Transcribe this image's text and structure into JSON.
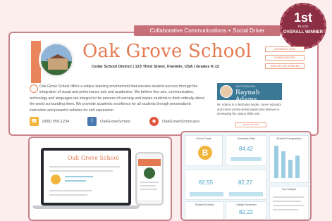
{
  "banner": {
    "text": "Collaborative Communications + Social Driver"
  },
  "badge": {
    "rank": "1st",
    "place": "PLACE",
    "award": "OVERALL WINNER"
  },
  "header": {
    "school_name": "Oak Grove School",
    "subtitle": "Cedar School District | 123 Third Street, Franklin, USA | Grades K-12"
  },
  "side_buttons": [
    "SCHEDULE VISIT",
    "DOWNLOAD PDF",
    "SIGN UP FOR UPDATES"
  ],
  "description": "Oak Grove School offers a unique learning environment that ensures student success through the integration of visual and performance arts and academics. We believe fine arts, communication, technology and languages are integral to the process of learning and inspire students to think critically about the world surrounding them. We promote academic excellence for all students through personalized instruction and powerful vehicles for self-expression.",
  "contacts": {
    "phone": "(800) 555-1234",
    "facebook": "OakGroveSchool",
    "web": "OakGroveSchool.gov"
  },
  "principal": {
    "meet": "MEET PRINCIPAL",
    "name": "Raynah Adams",
    "bio": "Mr. Adams is a dedicated leader, career educator and former profes-sional pianist who believes in developing the unique skills and...",
    "more": "READ FULL BIO"
  },
  "dashboard": {
    "tiles": [
      {
        "label": "School Grade",
        "grade": "B"
      },
      {
        "label": "Graduation Rate",
        "value": "84.42"
      },
      {
        "label": "Student Demographics",
        "value": ""
      },
      {
        "label": "Standards",
        "value": "82.55"
      },
      {
        "label": "Growth",
        "value": "82.27"
      },
      {
        "label": "Student Diversity",
        "value": ""
      },
      {
        "label": "College Enrollment",
        "value": "82.22"
      },
      {
        "label": "Top Colleges",
        "value": ""
      }
    ]
  },
  "colors": {
    "accent": "#e47a52",
    "frame": "#c98189",
    "badge": "#8c2f44",
    "teal": "#3a7896",
    "stat": "#4aa3c6"
  },
  "icons": {
    "phone": "phone-icon",
    "facebook": "facebook-icon",
    "web": "web-icon"
  }
}
